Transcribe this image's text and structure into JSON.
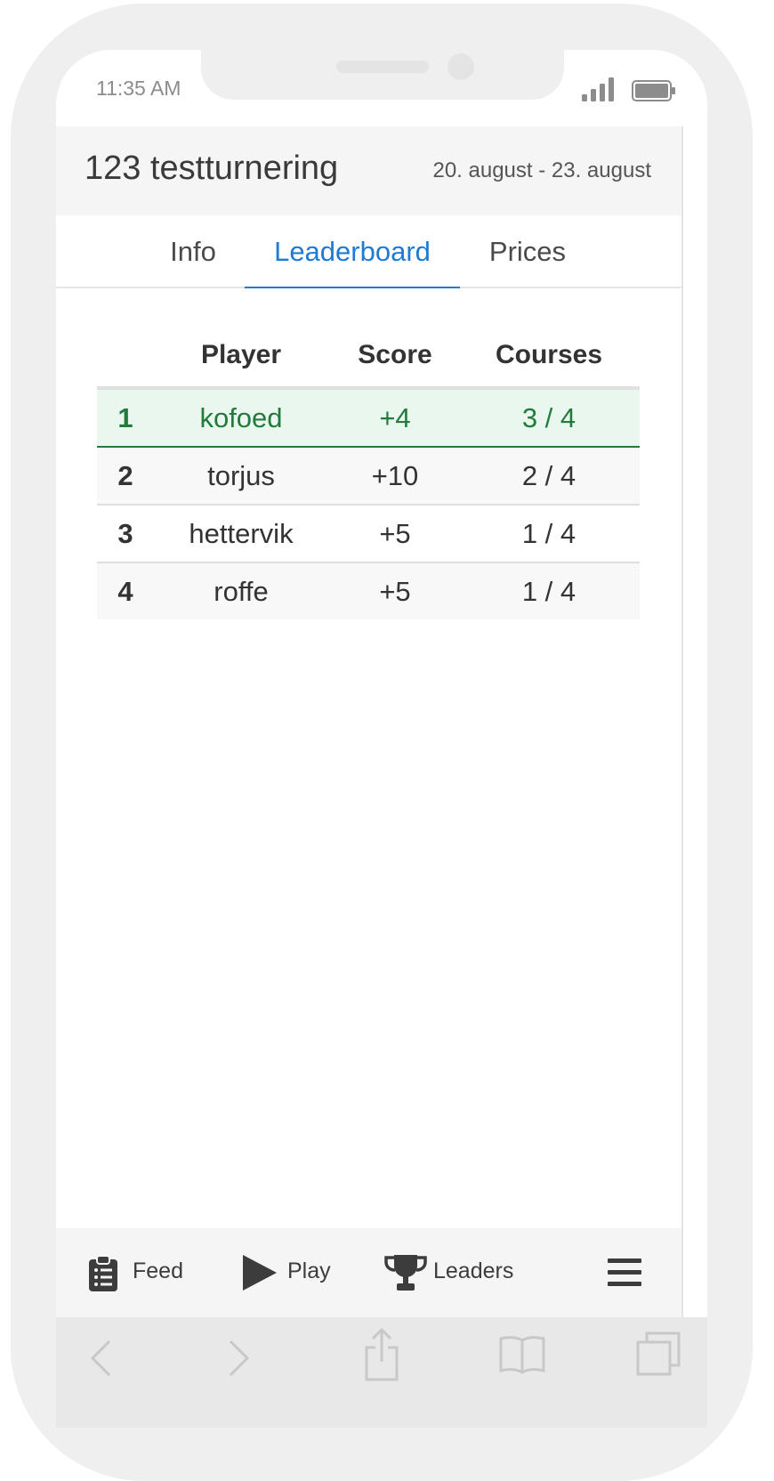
{
  "status_bar": {
    "time": "11:35 AM"
  },
  "header": {
    "title": "123 testturnering",
    "dates": "20. august - 23. august"
  },
  "tabs": [
    {
      "label": "Info",
      "active": false
    },
    {
      "label": "Leaderboard",
      "active": true
    },
    {
      "label": "Prices",
      "active": false
    }
  ],
  "leaderboard": {
    "columns": [
      "",
      "Player",
      "Score",
      "Courses"
    ],
    "rows": [
      {
        "rank": "1",
        "player": "kofoed",
        "score": "+4",
        "courses": "3 / 4"
      },
      {
        "rank": "2",
        "player": "torjus",
        "score": "+10",
        "courses": "2 / 4"
      },
      {
        "rank": "3",
        "player": "hettervik",
        "score": "+5",
        "courses": "1 / 4"
      },
      {
        "rank": "4",
        "player": "roffe",
        "score": "+5",
        "courses": "1 / 4"
      }
    ]
  },
  "bottom_nav": {
    "feed": {
      "label": "Feed",
      "icon": "clipboard-icon"
    },
    "play": {
      "label": "Play",
      "icon": "play-icon"
    },
    "leaders": {
      "label": "Leaders",
      "icon": "trophy-icon"
    },
    "menu": {
      "icon": "hamburger-menu-icon"
    }
  },
  "colors": {
    "accent": "#1f7ad3",
    "leader_green": "#227a3d",
    "leader_bg": "#e9f7ee"
  }
}
